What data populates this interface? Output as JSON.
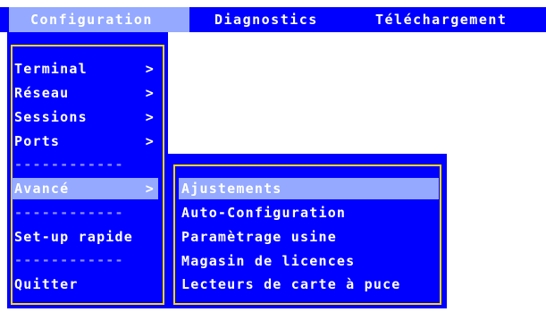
{
  "menubar": {
    "items": [
      {
        "label": "Configuration",
        "active": true
      },
      {
        "label": "Diagnostics",
        "active": false
      },
      {
        "label": "Téléchargement",
        "active": false
      }
    ]
  },
  "main_menu": {
    "items": [
      {
        "label": "Terminal",
        "arrow": ">"
      },
      {
        "label": "Réseau",
        "arrow": ">"
      },
      {
        "label": "Sessions",
        "arrow": ">"
      },
      {
        "label": "Ports",
        "arrow": ">"
      },
      {
        "label": "Avancé",
        "arrow": ">",
        "highlighted": true
      },
      {
        "label": "Set-up rapide"
      },
      {
        "label": "Quitter"
      }
    ],
    "separator": "------------"
  },
  "sub_menu": {
    "items": [
      {
        "label": "Ajustements",
        "highlighted": true
      },
      {
        "label": "Auto-Configuration"
      },
      {
        "label": "Paramètrage usine"
      },
      {
        "label": "Magasin de licences"
      },
      {
        "label": "Lecteurs de carte à puce"
      }
    ]
  },
  "colors": {
    "menu_bg": "#0000ff",
    "border": "#ffd800",
    "highlight": "#94a9ff",
    "text": "#ffffff",
    "separator": "#8f8fff"
  }
}
